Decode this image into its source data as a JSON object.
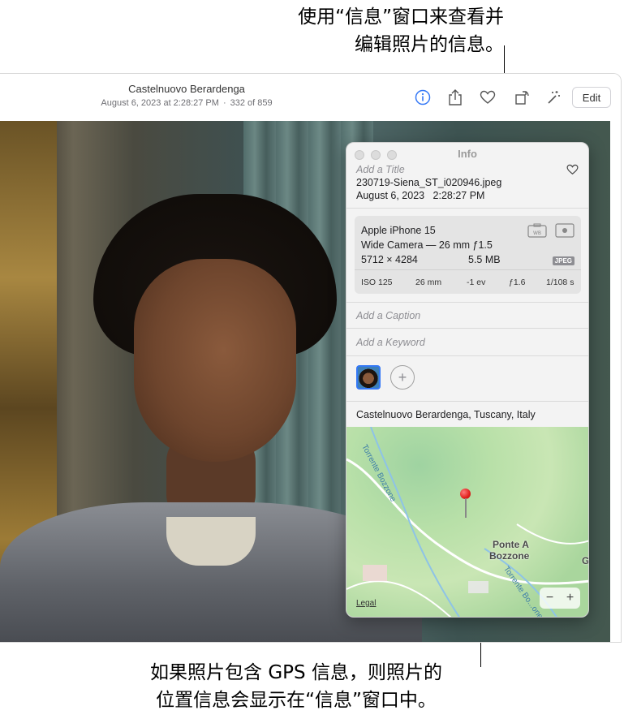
{
  "callouts": {
    "top_line1": "使用“信息”窗口来查看并",
    "top_line2": "编辑照片的信息。",
    "bottom_line1": "如果照片包含 GPS 信息，则照片的",
    "bottom_line2": "位置信息会显示在“信息”窗口中。"
  },
  "toolbar": {
    "title": "Castelnuovo Berardenga",
    "date": "August 6, 2023 at 2:28:27 PM",
    "separator": "·",
    "count": "332 of 859",
    "edit_label": "Edit",
    "icons": [
      "info-icon",
      "share-icon",
      "heart-icon",
      "rotate-icon",
      "magic-wand-icon"
    ],
    "accent": "#3478f6"
  },
  "info": {
    "window_title": "Info",
    "title_placeholder": "Add a Title",
    "filename": "230719-Siena_ST_i020946.jpeg",
    "date": "August 6, 2023",
    "time": "2:28:27 PM",
    "camera": "Apple iPhone 15",
    "lens": "Wide Camera — 26 mm ƒ1.5",
    "dimensions": "5712 × 4284",
    "size": "5.5 MB",
    "format_badge": "JPEG",
    "exposure": {
      "iso": "ISO 125",
      "focal": "26 mm",
      "ev": "-1 ev",
      "aperture": "ƒ1.6",
      "shutter": "1/108 s"
    },
    "caption_placeholder": "Add a Caption",
    "keyword_placeholder": "Add a Keyword",
    "location": "Castelnuovo Berardenga, Tuscany, Italy",
    "map": {
      "place_label_line1": "Ponte A",
      "place_label_line2": "Bozzone",
      "river_label_1": "Torrente Bozzone",
      "river_label_2": "Torrente Bo...one",
      "edge_label": "G",
      "legal": "Legal",
      "zoom_out": "−",
      "zoom_in": "+"
    }
  }
}
